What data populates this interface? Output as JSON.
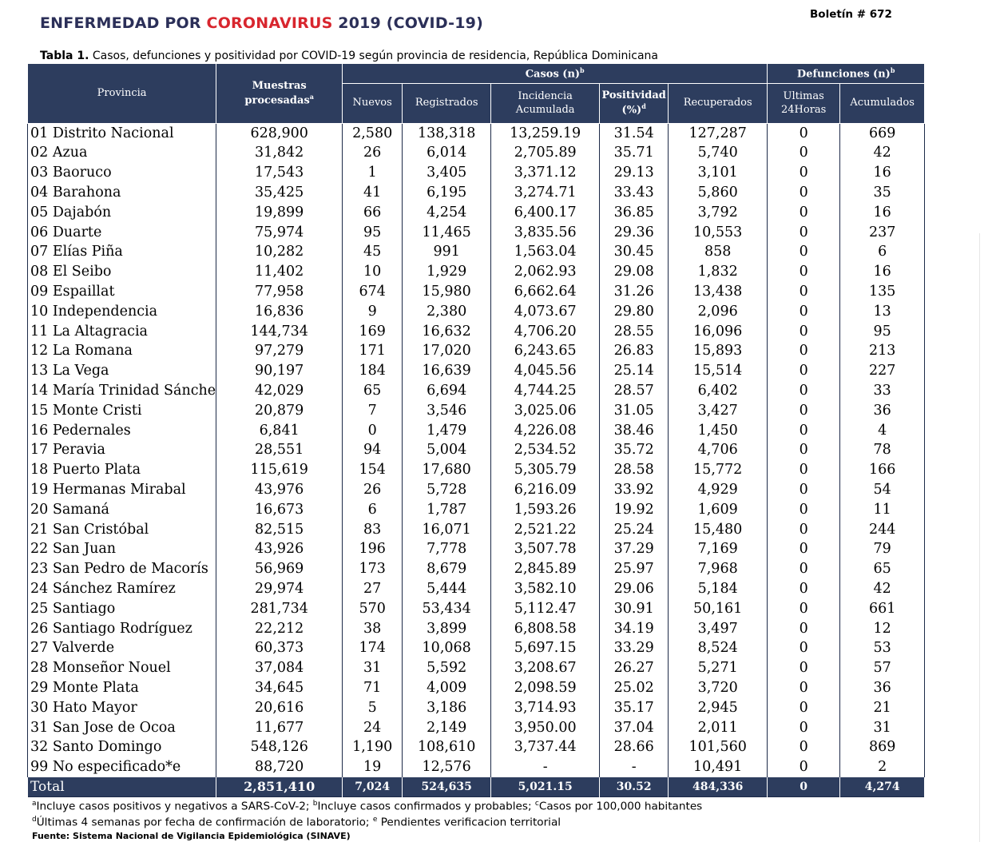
{
  "header": {
    "title_pre": "ENFERMEDAD POR ",
    "title_corona": "CORONAVIRUS",
    "title_post": " 2019 (COVID-19)",
    "bulletin": "Boletín # 672",
    "caption_label": "Tabla 1.",
    "caption_text": " Casos, defunciones y positividad por COVID-19 según provincia de residencia, República Dominicana"
  },
  "colors": {
    "header_bg": "#2d3d5e",
    "title_text": "#2b2f58",
    "title_accent": "#d8262e"
  },
  "table": {
    "col_provincia": "Provincia",
    "col_muestras": "Muestras procesadas",
    "col_muestras_sup": "a",
    "group_casos": "Casos (n)",
    "group_casos_sup": "b",
    "group_defunciones": "Defunciones (n)",
    "group_defunciones_sup": "b",
    "col_nuevos": "Nuevos",
    "col_registrados": "Registrados",
    "col_incidencia_1": "Incidencia",
    "col_incidencia_2": "Acumulada",
    "col_positividad_1": "Positividad",
    "col_positividad_2": "(%)",
    "col_positividad_sup": "d",
    "col_recuperados": "Recuperados",
    "col_ultimas_1": "Ultimas",
    "col_ultimas_2": "24Horas",
    "col_acumulados": "Acumulados",
    "rows": [
      [
        "01 Distrito Nacional",
        "628,900",
        "2,580",
        "138,318",
        "13,259.19",
        "31.54",
        "127,287",
        "0",
        "669"
      ],
      [
        "02 Azua",
        "31,842",
        "26",
        "6,014",
        "2,705.89",
        "35.71",
        "5,740",
        "0",
        "42"
      ],
      [
        "03 Baoruco",
        "17,543",
        "1",
        "3,405",
        "3,371.12",
        "29.13",
        "3,101",
        "0",
        "16"
      ],
      [
        "04 Barahona",
        "35,425",
        "41",
        "6,195",
        "3,274.71",
        "33.43",
        "5,860",
        "0",
        "35"
      ],
      [
        "05 Dajabón",
        "19,899",
        "66",
        "4,254",
        "6,400.17",
        "36.85",
        "3,792",
        "0",
        "16"
      ],
      [
        "06 Duarte",
        "75,974",
        "95",
        "11,465",
        "3,835.56",
        "29.36",
        "10,553",
        "0",
        "237"
      ],
      [
        "07 Elías Piña",
        "10,282",
        "45",
        "991",
        "1,563.04",
        "30.45",
        "858",
        "0",
        "6"
      ],
      [
        "08 El Seibo",
        "11,402",
        "10",
        "1,929",
        "2,062.93",
        "29.08",
        "1,832",
        "0",
        "16"
      ],
      [
        "09 Espaillat",
        "77,958",
        "674",
        "15,980",
        "6,662.64",
        "31.26",
        "13,438",
        "0",
        "135"
      ],
      [
        "10 Independencia",
        "16,836",
        "9",
        "2,380",
        "4,073.67",
        "29.80",
        "2,096",
        "0",
        "13"
      ],
      [
        "11 La Altagracia",
        "144,734",
        "169",
        "16,632",
        "4,706.20",
        "28.55",
        "16,096",
        "0",
        "95"
      ],
      [
        "12 La Romana",
        "97,279",
        "171",
        "17,020",
        "6,243.65",
        "26.83",
        "15,893",
        "0",
        "213"
      ],
      [
        "13 La Vega",
        "90,197",
        "184",
        "16,639",
        "4,045.56",
        "25.14",
        "15,514",
        "0",
        "227"
      ],
      [
        "14 María Trinidad Sánche",
        "42,029",
        "65",
        "6,694",
        "4,744.25",
        "28.57",
        "6,402",
        "0",
        "33"
      ],
      [
        "15 Monte Cristi",
        "20,879",
        "7",
        "3,546",
        "3,025.06",
        "31.05",
        "3,427",
        "0",
        "36"
      ],
      [
        "16 Pedernales",
        "6,841",
        "0",
        "1,479",
        "4,226.08",
        "38.46",
        "1,450",
        "0",
        "4"
      ],
      [
        "17 Peravia",
        "28,551",
        "94",
        "5,004",
        "2,534.52",
        "35.72",
        "4,706",
        "0",
        "78"
      ],
      [
        "18 Puerto Plata",
        "115,619",
        "154",
        "17,680",
        "5,305.79",
        "28.58",
        "15,772",
        "0",
        "166"
      ],
      [
        "19 Hermanas Mirabal",
        "43,976",
        "26",
        "5,728",
        "6,216.09",
        "33.92",
        "4,929",
        "0",
        "54"
      ],
      [
        "20 Samaná",
        "16,673",
        "6",
        "1,787",
        "1,593.26",
        "19.92",
        "1,609",
        "0",
        "11"
      ],
      [
        "21 San Cristóbal",
        "82,515",
        "83",
        "16,071",
        "2,521.22",
        "25.24",
        "15,480",
        "0",
        "244"
      ],
      [
        "22 San Juan",
        "43,926",
        "196",
        "7,778",
        "3,507.78",
        "37.29",
        "7,169",
        "0",
        "79"
      ],
      [
        "23 San Pedro de Macorís",
        "56,969",
        "173",
        "8,679",
        "2,845.89",
        "25.97",
        "7,968",
        "0",
        "65"
      ],
      [
        "24 Sánchez Ramírez",
        "29,974",
        "27",
        "5,444",
        "3,582.10",
        "29.06",
        "5,184",
        "0",
        "42"
      ],
      [
        "25 Santiago",
        "281,734",
        "570",
        "53,434",
        "5,112.47",
        "30.91",
        "50,161",
        "0",
        "661"
      ],
      [
        "26 Santiago Rodríguez",
        "22,212",
        "38",
        "3,899",
        "6,808.58",
        "34.19",
        "3,497",
        "0",
        "12"
      ],
      [
        "27 Valverde",
        "60,373",
        "174",
        "10,068",
        "5,697.15",
        "33.29",
        "8,524",
        "0",
        "53"
      ],
      [
        "28 Monseñor Nouel",
        "37,084",
        "31",
        "5,592",
        "3,208.67",
        "26.27",
        "5,271",
        "0",
        "57"
      ],
      [
        "29 Monte Plata",
        "34,645",
        "71",
        "4,009",
        "2,098.59",
        "25.02",
        "3,720",
        "0",
        "36"
      ],
      [
        "30 Hato Mayor",
        "20,616",
        "5",
        "3,186",
        "3,714.93",
        "35.17",
        "2,945",
        "0",
        "21"
      ],
      [
        "31 San Jose de Ocoa",
        "11,677",
        "24",
        "2,149",
        "3,950.00",
        "37.04",
        "2,011",
        "0",
        "31"
      ],
      [
        "32 Santo Domingo",
        "548,126",
        "1,190",
        "108,610",
        "3,737.44",
        "28.66",
        "101,560",
        "0",
        "869"
      ],
      [
        "99 No especificado*e",
        "88,720",
        "19",
        "12,576",
        "-",
        "-",
        "10,491",
        "0",
        "2"
      ]
    ],
    "total": [
      "Total",
      "2,851,410",
      "7,024",
      "524,635",
      "5,021.15",
      "30.52",
      "484,336",
      "0",
      "4,274"
    ]
  },
  "footnotes": {
    "line1_a": "a",
    "line1_a_text": "Incluye casos positivos y negativos a SARS-CoV-2; ",
    "line1_b": "b",
    "line1_b_text": "Incluye casos confirmados y probables; ",
    "line1_c": "c",
    "line1_c_text": "Casos por 100,000 habitantes",
    "line2_d": "d",
    "line2_d_text": "Últimas 4 semanas por fecha de confirmación de laboratorio; ",
    "line2_e": "e",
    "line2_e_text": " Pendientes verificacion territorial",
    "source": "Fuente: Sistema Nacional de Vigilancia Epidemiológica (SINAVE)"
  }
}
